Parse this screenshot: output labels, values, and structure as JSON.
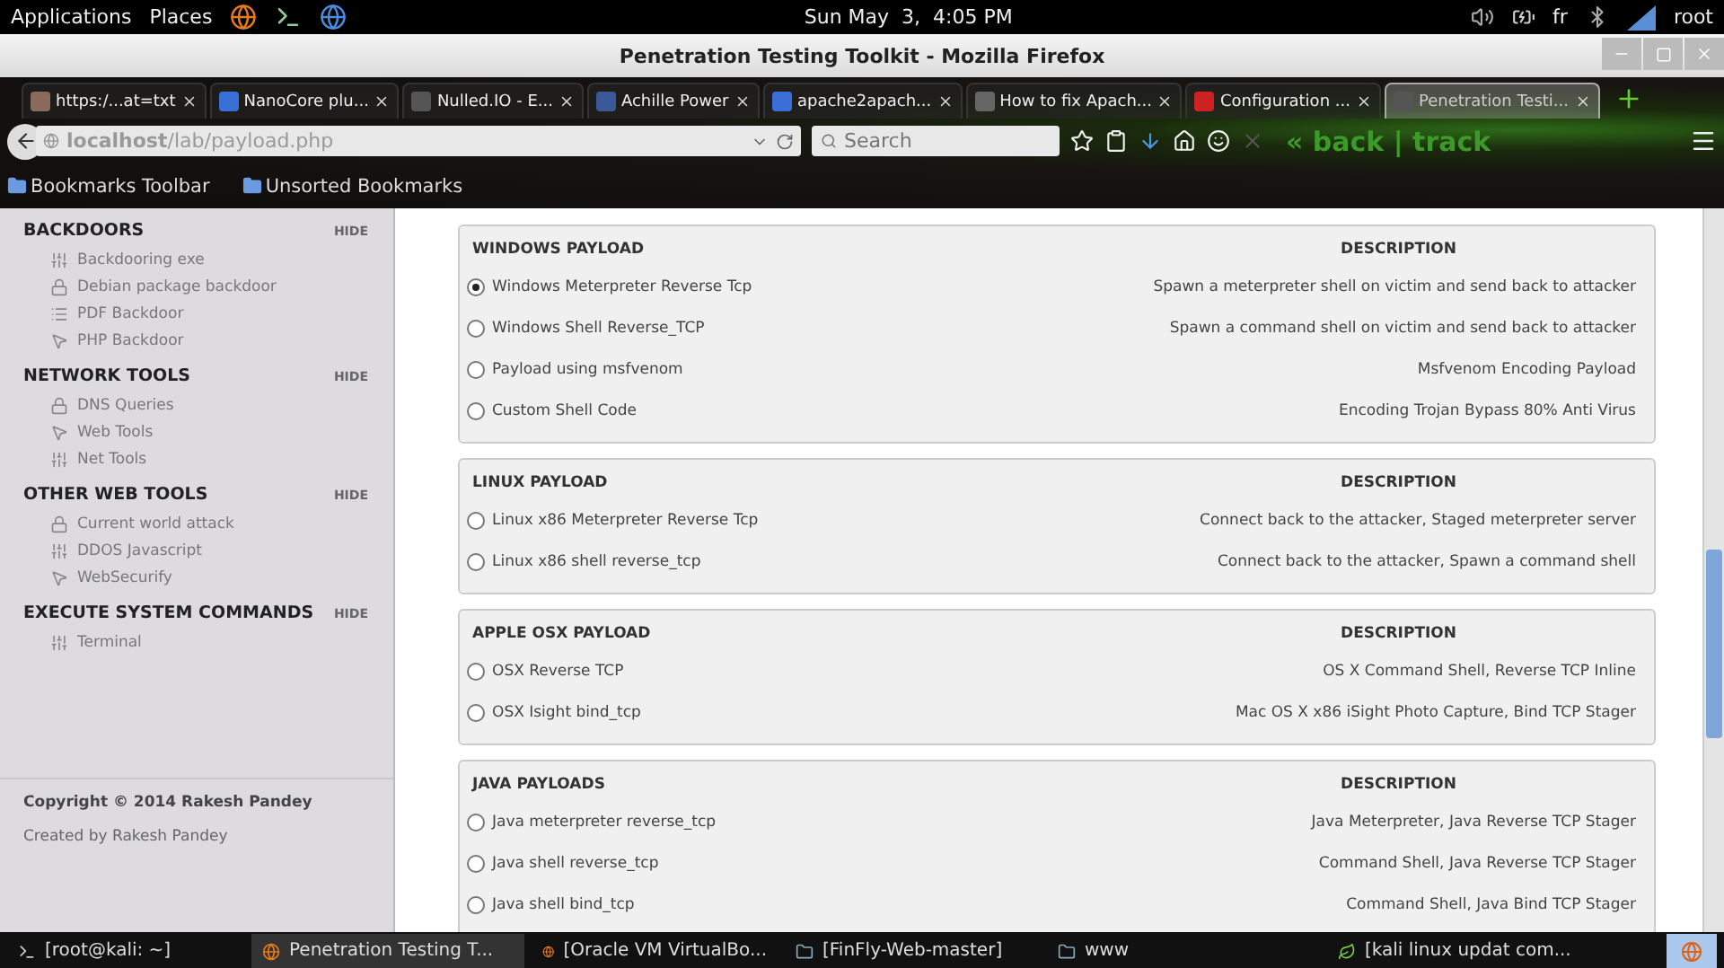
{
  "top_panel": {
    "menus": [
      "Applications",
      "Places"
    ],
    "clock": "Sun May  3,  4:05 PM",
    "keyboard_layout": "fr",
    "user": "root"
  },
  "window": {
    "title": "Penetration Testing Toolkit - Mozilla Firefox"
  },
  "tabs": [
    {
      "label": "https:/...at=txt",
      "selected": false
    },
    {
      "label": "NanoCore plu...",
      "selected": false
    },
    {
      "label": "Nulled.IO - E...",
      "selected": false
    },
    {
      "label": "Achille Power",
      "selected": false
    },
    {
      "label": "apache2apach...",
      "selected": false
    },
    {
      "label": "How to fix Apach...",
      "selected": false
    },
    {
      "label": "Configuration ...",
      "selected": false
    },
    {
      "label": "Penetration Testi...",
      "selected": true
    }
  ],
  "address_bar": {
    "url": "**localhost**/lab/payload.php",
    "search_placeholder": "Search"
  },
  "theme_logo": "« back | track",
  "bookmarks": [
    "Bookmarks Toolbar",
    "Unsorted Bookmarks"
  ],
  "sidebar": {
    "sections": [
      {
        "title": "BACKDOORS",
        "action": "HIDE",
        "items": [
          {
            "label": "Backdooring exe",
            "kind": "sliders"
          },
          {
            "label": "Debian package backdoor",
            "kind": "lock"
          },
          {
            "label": "PDF Backdoor",
            "kind": "list"
          },
          {
            "label": "PHP Backdoor",
            "kind": "pointer"
          }
        ]
      },
      {
        "title": "NETWORK TOOLS",
        "action": "HIDE",
        "items": [
          {
            "label": "DNS Queries",
            "kind": "lock"
          },
          {
            "label": "Web Tools",
            "kind": "pointer"
          },
          {
            "label": "Net Tools",
            "kind": "sliders"
          }
        ]
      },
      {
        "title": "OTHER WEB TOOLS",
        "action": "HIDE",
        "items": [
          {
            "label": "Current world attack",
            "kind": "lock"
          },
          {
            "label": "DDOS Javascript",
            "kind": "sliders"
          },
          {
            "label": "WebSecurify",
            "kind": "pointer"
          }
        ]
      },
      {
        "title": "EXECUTE SYSTEM COMMANDS",
        "action": "HIDE",
        "items": [
          {
            "label": "Terminal",
            "kind": "sliders"
          }
        ]
      }
    ],
    "copyright": "Copyright © 2014 Rakesh Pandey",
    "credit": "Created by Rakesh Pandey"
  },
  "payload_groups": [
    {
      "title": "WINDOWS PAYLOAD",
      "description_heading": "DESCRIPTION",
      "options": [
        {
          "label": "Windows Meterpreter Reverse Tcp",
          "description": "Spawn a meterpreter shell on victim and send back to attacker",
          "selected": true
        },
        {
          "label": "Windows Shell Reverse_TCP",
          "description": "Spawn a command shell on victim and send back to attacker",
          "selected": false
        },
        {
          "label": "Payload using msfvenom",
          "description": "Msfvenom Encoding Payload",
          "selected": false
        },
        {
          "label": "Custom Shell Code",
          "description": "Encoding Trojan Bypass 80% Anti Virus",
          "selected": false
        }
      ]
    },
    {
      "title": "LINUX PAYLOAD",
      "description_heading": "DESCRIPTION",
      "options": [
        {
          "label": "Linux x86 Meterpreter Reverse Tcp",
          "description": "Connect back to the attacker, Staged meterpreter server",
          "selected": false
        },
        {
          "label": "Linux x86 shell reverse_tcp",
          "description": "Connect back to the attacker, Spawn a command shell",
          "selected": false
        }
      ]
    },
    {
      "title": "APPLE OSX PAYLOAD",
      "description_heading": "DESCRIPTION",
      "options": [
        {
          "label": "OSX Reverse TCP",
          "description": "OS X Command Shell, Reverse TCP Inline",
          "selected": false
        },
        {
          "label": "OSX Isight bind_tcp",
          "description": "Mac OS X x86 iSight Photo Capture, Bind TCP Stager",
          "selected": false
        }
      ]
    },
    {
      "title": "JAVA PAYLOADS",
      "description_heading": "DESCRIPTION",
      "options": [
        {
          "label": "Java meterpreter reverse_tcp",
          "description": "Java Meterpreter, Java Reverse TCP Stager",
          "selected": false
        },
        {
          "label": "Java shell reverse_tcp",
          "description": "Command Shell, Java Reverse TCP Stager",
          "selected": false
        },
        {
          "label": "Java shell bind_tcp",
          "description": "Command Shell, Java Bind TCP Stager",
          "selected": false
        }
      ]
    }
  ],
  "taskbar": [
    {
      "label": "[root@kali: ~]",
      "selected": false
    },
    {
      "label": "Penetration Testing T...",
      "selected": true
    },
    {
      "label": "[Oracle VM VirtualBo...",
      "selected": false
    },
    {
      "label": "[FinFly-Web-master]",
      "selected": false
    },
    {
      "label": "www",
      "selected": false
    },
    {
      "label": "[kali linux updat com...",
      "selected": false
    }
  ]
}
